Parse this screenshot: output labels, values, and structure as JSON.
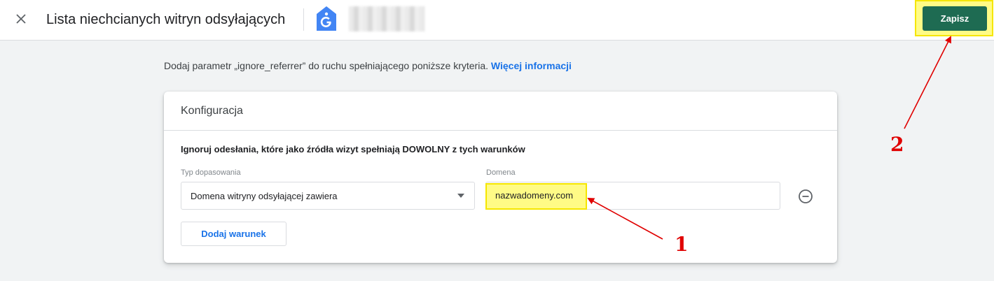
{
  "header": {
    "close_icon": "close-icon",
    "title": "Lista niechcianych witryn odsyłających",
    "logo_icon": "tag-manager-icon",
    "save_label": "Zapisz"
  },
  "description": {
    "text": "Dodaj parametr „ignore_referrer” do ruchu spełniającego poniższe kryteria.",
    "link": "Więcej informacji"
  },
  "card": {
    "title": "Konfiguracja",
    "condition_title": "Ignoruj odesłania, które jako źródła wizyt spełniają DOWOLNY z tych warunków",
    "match_type_label": "Typ dopasowania",
    "match_type_value": "Domena witryny odsyłającej zawiera",
    "domain_label": "Domena",
    "domain_value": "nazwadomeny.com",
    "remove_icon": "remove-circle-icon",
    "add_condition_label": "Dodaj warunek"
  },
  "annotations": {
    "marker_1": "1",
    "marker_2": "2"
  },
  "colors": {
    "primary_green": "#1e6b52",
    "link_blue": "#1a73e8",
    "highlight_yellow": "#fffb86",
    "annotation_red": "#e00000"
  }
}
